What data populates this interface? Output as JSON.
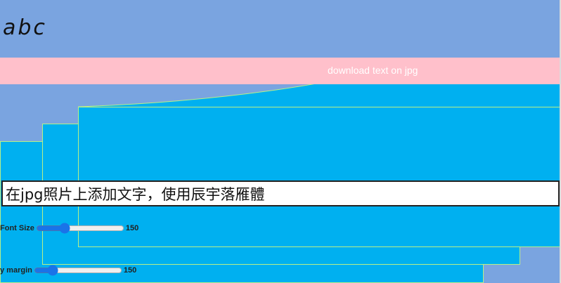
{
  "preview": {
    "text": "abc"
  },
  "banner": {
    "download_label": "download text on jpg"
  },
  "input": {
    "value": "在jpg照片上添加文字，使用辰宇落雁體"
  },
  "controls": {
    "font_size": {
      "label": "Font Size",
      "value": "150",
      "slider_fraction": 0.3
    },
    "y_margin": {
      "label": "y margin",
      "value": "150",
      "slider_fraction": 0.17
    }
  },
  "colors": {
    "background": "#7aa4e0",
    "band": "#ffc0cb",
    "panel": "#00b0f0",
    "panel_border": "#b8f088",
    "slider_accent": "#1a73e8"
  }
}
